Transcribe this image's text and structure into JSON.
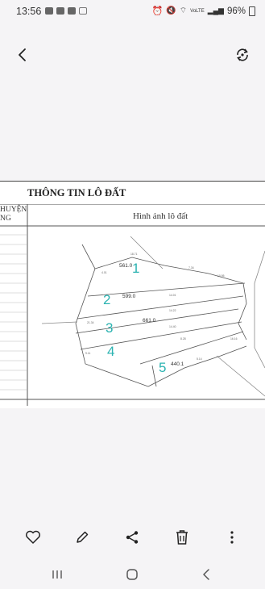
{
  "status_bar": {
    "time": "13:56",
    "network": "VoLTE",
    "battery": "96%"
  },
  "document": {
    "title": "THÔNG TIN LÔ ĐẤT",
    "left_header_line1": "HUYỆN",
    "left_header_line2": "NG",
    "right_header": "Hình ảnh lô đất",
    "lots": [
      {
        "number": "1",
        "area": "561.0"
      },
      {
        "number": "2",
        "area": "599.0"
      },
      {
        "number": "3",
        "area": "661.0"
      },
      {
        "number": "4",
        "area": ""
      },
      {
        "number": "5",
        "area": "440.1"
      }
    ],
    "colors": {
      "lot_number": "#2bb3b1",
      "line": "#555555"
    }
  },
  "actions": {
    "favorite": "heart-icon",
    "edit": "pencil-icon",
    "share": "share-icon",
    "delete": "trash-icon",
    "more": "more-vertical-icon"
  },
  "navigation": {
    "recent": "recent-apps-icon",
    "home": "home-icon",
    "back": "back-nav-icon"
  }
}
